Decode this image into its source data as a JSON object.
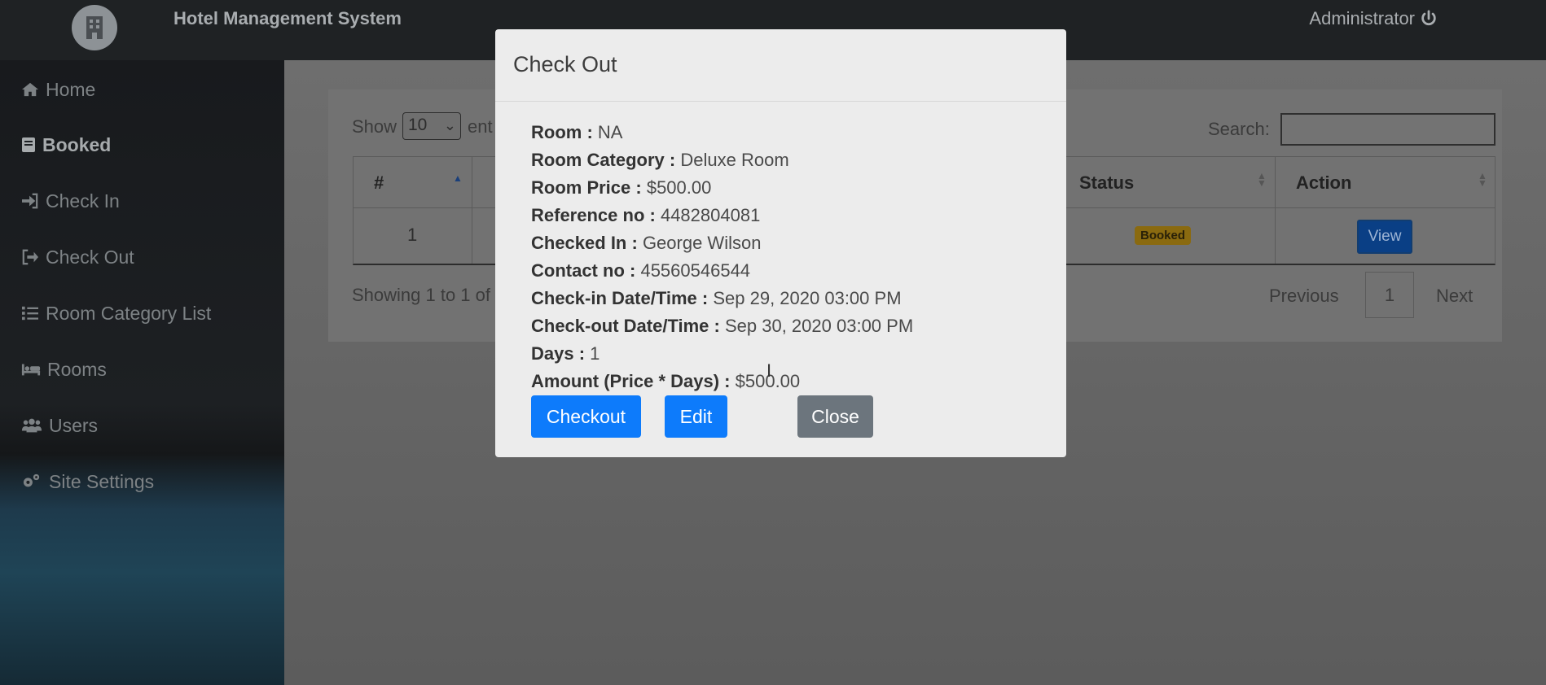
{
  "header": {
    "title": "Hotel Management System",
    "user": "Administrator"
  },
  "sidebar": {
    "items": [
      {
        "label": "Home",
        "icon": "home-icon"
      },
      {
        "label": "Booked",
        "icon": "book-icon"
      },
      {
        "label": "Check In",
        "icon": "sign-in-icon"
      },
      {
        "label": "Check Out",
        "icon": "sign-out-icon"
      },
      {
        "label": "Room Category List",
        "icon": "list-icon"
      },
      {
        "label": "Rooms",
        "icon": "bed-icon"
      },
      {
        "label": "Users",
        "icon": "users-icon"
      },
      {
        "label": "Site Settings",
        "icon": "cogs-icon"
      }
    ]
  },
  "table": {
    "show_label": "Show",
    "entries_value": "10",
    "entries_tail": "ent",
    "search_label": "Search:",
    "columns": [
      "#",
      "Status",
      "Action"
    ],
    "rows": [
      {
        "num": "1",
        "status": "Booked",
        "action": "View"
      }
    ],
    "showing": "Showing 1 to 1 of",
    "pagination": {
      "prev": "Previous",
      "page": "1",
      "next": "Next"
    }
  },
  "modal": {
    "title": "Check Out",
    "fields": [
      {
        "label": "Room :",
        "value": "NA"
      },
      {
        "label": "Room Category :",
        "value": "Deluxe Room"
      },
      {
        "label": "Room Price :",
        "value": "$500.00"
      },
      {
        "label": "Reference no :",
        "value": "4482804081"
      },
      {
        "label": "Checked In :",
        "value": "George Wilson"
      },
      {
        "label": "Contact no :",
        "value": "45560546544"
      },
      {
        "label": "Check-in Date/Time :",
        "value": "Sep 29, 2020 03:00 PM"
      },
      {
        "label": "Check-out Date/Time :",
        "value": "Sep 30, 2020 03:00 PM"
      },
      {
        "label": "Days :",
        "value": "1"
      },
      {
        "label": "Amount (Price * Days) :",
        "value": "$500.00"
      }
    ],
    "buttons": {
      "checkout": "Checkout",
      "edit": "Edit",
      "close": "Close"
    }
  },
  "colors": {
    "primary": "#0d7bfb",
    "secondary": "#6c757d",
    "badge": "#ffc107"
  }
}
